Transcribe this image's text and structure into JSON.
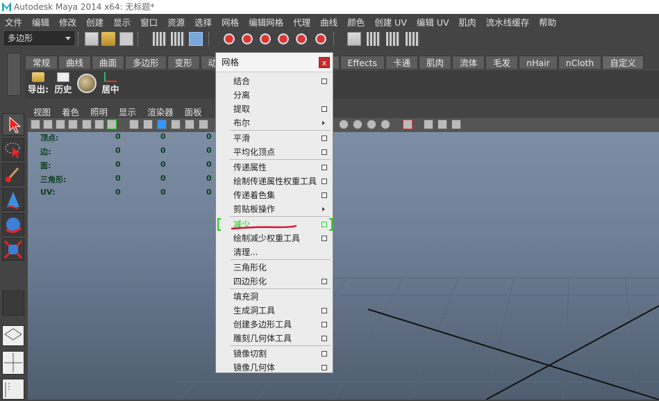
{
  "titlebar": {
    "title": "Autodesk Maya 2014 x64: 无标题*"
  },
  "menubar": {
    "items": [
      "文件",
      "编辑",
      "修改",
      "创建",
      "显示",
      "窗口",
      "资源",
      "选择",
      "网格",
      "编辑网格",
      "代理",
      "曲线",
      "颜色",
      "创建 UV",
      "编辑 UV",
      "肌肉",
      "流水线缓存",
      "帮助"
    ]
  },
  "toolbar": {
    "mode_combo": "多边形"
  },
  "shelf": {
    "tabs": [
      "常规",
      "曲线",
      "曲面",
      "多边形",
      "变形",
      "动",
      "Effects",
      "卡通",
      "肌肉",
      "流体",
      "毛发",
      "nHair",
      "nCloth",
      "自定义"
    ],
    "active_tab": "自定义",
    "buttons": [
      "导出:",
      "历史",
      "",
      "居中"
    ]
  },
  "panel": {
    "menu": [
      "视图",
      "着色",
      "照明",
      "显示",
      "渲染器",
      "面板"
    ]
  },
  "hud": {
    "rows": [
      {
        "label": "顶点:",
        "values": [
          "0",
          "0",
          "0"
        ]
      },
      {
        "label": "边:",
        "values": [
          "0",
          "0",
          "0"
        ]
      },
      {
        "label": "面:",
        "values": [
          "0",
          "0",
          "0"
        ]
      },
      {
        "label": "三角形:",
        "values": [
          "0",
          "0",
          "0"
        ]
      },
      {
        "label": "UV:",
        "values": [
          "0",
          "0",
          "0"
        ]
      }
    ]
  },
  "mesh_menu": {
    "title": "网格",
    "close": "x",
    "items": [
      {
        "label": "结合",
        "box": true
      },
      {
        "label": "分离",
        "box": false
      },
      {
        "label": "提取",
        "box": true
      },
      {
        "label": "布尔",
        "sub": true
      },
      {
        "sep": true
      },
      {
        "label": "平滑",
        "box": true
      },
      {
        "label": "平均化顶点",
        "box": true
      },
      {
        "sep": true
      },
      {
        "label": "传递属性",
        "box": true
      },
      {
        "label": "绘制传递属性权重工具",
        "box": true
      },
      {
        "label": "传递着色集",
        "box": true
      },
      {
        "label": "剪贴板操作",
        "sub": true
      },
      {
        "sep": true
      },
      {
        "label": "减少",
        "box": true,
        "highlight": true
      },
      {
        "label": "绘制减少权重工具",
        "box": true
      },
      {
        "label": "清理...",
        "box": false
      },
      {
        "sep": true
      },
      {
        "label": "三角形化",
        "box": false
      },
      {
        "label": "四边形化",
        "box": true
      },
      {
        "sep": true
      },
      {
        "label": "填充洞",
        "box": false
      },
      {
        "label": "生成洞工具",
        "box": true
      },
      {
        "label": "创建多边形工具",
        "box": true
      },
      {
        "label": "雕刻几何体工具",
        "box": true
      },
      {
        "sep": true
      },
      {
        "label": "镜像切割",
        "box": true
      },
      {
        "label": "镜像几何体",
        "box": true
      }
    ]
  },
  "colors": {
    "highlight": "#17c717",
    "annotation": "#e0112b"
  }
}
